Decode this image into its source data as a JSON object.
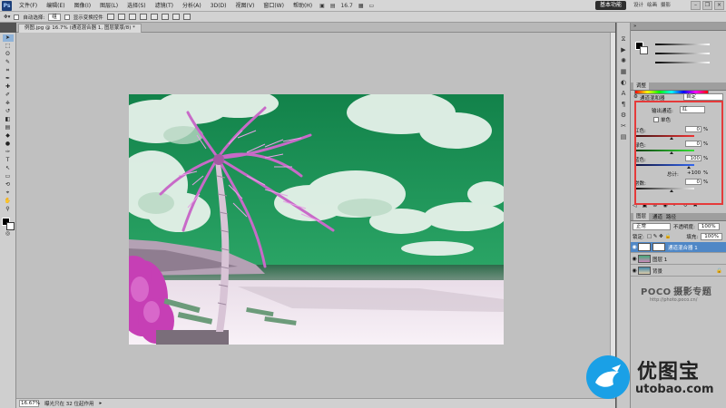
{
  "app": {
    "logo": "Ps",
    "menu": [
      "文件(F)",
      "编辑(E)",
      "图像(I)",
      "图层(L)",
      "选择(S)",
      "滤镜(T)",
      "分析(A)",
      "3D(D)",
      "视图(V)",
      "窗口(W)",
      "帮助(H)"
    ],
    "zoom_display": "16.7",
    "workspace_button": "基本功能",
    "workspace_links": [
      "设计",
      "绘画",
      "摄影"
    ]
  },
  "options_bar": {
    "auto_select_label": "自动选择:",
    "auto_select_value": "组",
    "show_transform_label": "显示变换控件"
  },
  "document": {
    "tab_title": "例图.jpg @ 16.7% (通道混合器 1, 图层蒙版/8) *",
    "status_zoom": "16.67%",
    "status_info": "曝光只在 32 位起作用"
  },
  "adjustments_panel": {
    "tab": "调整",
    "preset_label": "通道混和器",
    "preset_value": "自定",
    "output_channel_label": "输出通道:",
    "output_channel_value": "红",
    "monochrome_label": "单色",
    "red_label": "红色:",
    "red_value": "0",
    "green_label": "绿色:",
    "green_value": "0",
    "blue_label": "蓝色:",
    "blue_value": "100",
    "total_label": "总计:",
    "total_value": "+100",
    "constant_label": "常数:",
    "constant_value": "0",
    "percent": "%"
  },
  "layers_panel": {
    "tabs": [
      "图层",
      "通道",
      "路径"
    ],
    "blend_mode": "正常",
    "opacity_label": "不透明度:",
    "opacity_value": "100%",
    "lock_label": "锁定:",
    "fill_label": "填充:",
    "fill_value": "100%",
    "layers": [
      {
        "name": "通道混合器 1",
        "selected": true
      },
      {
        "name": "图层 1",
        "selected": false
      },
      {
        "name": "背景",
        "selected": false
      }
    ]
  },
  "watermark": {
    "poco": "POCO",
    "title": "摄影专题",
    "url": "http://photo.poco.cn/"
  },
  "brand": {
    "name": "优图宝",
    "url": "utobao.com"
  },
  "colors": {
    "sky_green": "#1f9a55",
    "palm_pink": "#c860c8",
    "highlight_frame": "#e53a3a",
    "selected_layer": "#4f87c6"
  }
}
